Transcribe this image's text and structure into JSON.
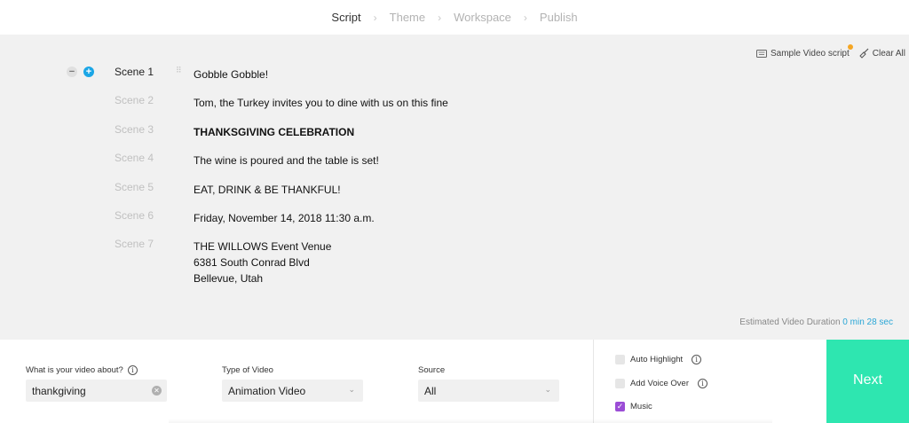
{
  "steps": [
    {
      "label": "Script"
    },
    {
      "label": "Theme"
    },
    {
      "label": "Workspace"
    },
    {
      "label": "Publish"
    }
  ],
  "toolbar": {
    "sample_label": "Sample Video script",
    "clear_label": "Clear All"
  },
  "scenes": [
    {
      "label": "Scene 1",
      "lines": [
        "Gobble Gobble!"
      ]
    },
    {
      "label": "Scene 2",
      "lines": [
        "Tom, the Turkey invites you to dine with us on this fine"
      ]
    },
    {
      "label": "Scene 3",
      "lines": [
        "THANKSGIVING CELEBRATION"
      ]
    },
    {
      "label": "Scene 4",
      "lines": [
        "The wine is poured and the table is set!"
      ]
    },
    {
      "label": "Scene 5",
      "lines": [
        "EAT, DRINK & BE THANKFUL!"
      ]
    },
    {
      "label": "Scene 6",
      "lines": [
        "Friday, November 14, 2018 11:30 a.m."
      ]
    },
    {
      "label": "Scene 7",
      "lines": [
        "THE WILLOWS Event Venue",
        "6381 South Conrad Blvd",
        "Bellevue, Utah"
      ]
    }
  ],
  "duration": {
    "label": "Estimated Video Duration",
    "value": "0 min 28 sec"
  },
  "form": {
    "about_label": "What is your video about?",
    "about_value": "thankgiving",
    "type_label": "Type of Video",
    "type_value": "Animation Video",
    "source_label": "Source",
    "source_value": "All"
  },
  "options": [
    {
      "label": "Auto Highlight",
      "checked": false
    },
    {
      "label": "Add Voice Over",
      "checked": false
    },
    {
      "label": "Music",
      "checked": true
    }
  ],
  "next_label": "Next",
  "colors": {
    "accent_blue": "#1ba6e6",
    "next_green": "#2ee6b0",
    "checkbox_purple": "#9b4dd6",
    "badge_orange": "#f5a623"
  }
}
